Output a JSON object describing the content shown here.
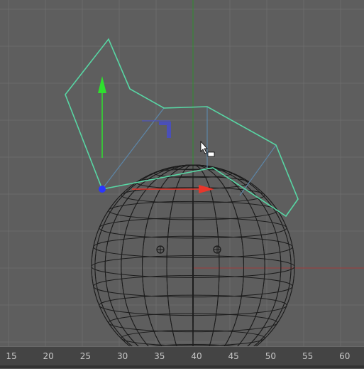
{
  "viewport": {
    "grid_color": "#6b6b6b",
    "axis_y_color": "#2f8f2f",
    "axis_x_color": "#a13a3a",
    "wireframe_color": "#1c1c1c",
    "selection_color": "#58d6a4",
    "manip_x_color": "#e8362b",
    "manip_y_color": "#2ee02e",
    "manip_plane_color": "#4a4fb8",
    "pivot_color": "#2a36ff"
  },
  "timeline": {
    "labels": [
      "15",
      "20",
      "25",
      "30",
      "35",
      "40",
      "45",
      "50",
      "55",
      "60"
    ]
  }
}
